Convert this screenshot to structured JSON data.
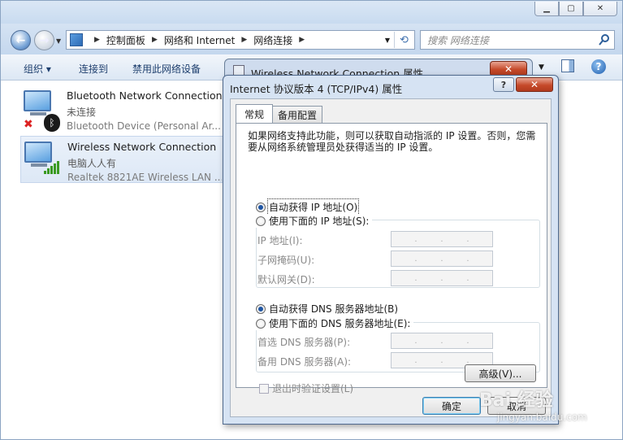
{
  "explorer": {
    "breadcrumb": [
      "控制面板",
      "网络和 Internet",
      "网络连接"
    ],
    "search_placeholder": "搜索 网络连接",
    "toolbar": {
      "organize": "组织 ▾",
      "connect": "连接到",
      "disable": "禁用此网络设备"
    },
    "connections": [
      {
        "name": "Bluetooth Network Connection",
        "status": "未连接",
        "device": "Bluetooth Device (Personal Ar..."
      },
      {
        "name": "Wireless Network Connection",
        "status": "电脑人人有",
        "device": "Realtek 8821AE Wireless LAN ..."
      }
    ]
  },
  "bg_dialog": {
    "title": "Wireless Network Connection 属性"
  },
  "dialog": {
    "title": "Internet 协议版本 4 (TCP/IPv4) 属性",
    "tabs": [
      "常规",
      "备用配置"
    ],
    "description": "如果网络支持此功能，则可以获取自动指派的 IP 设置。否则，您需要从网络系统管理员处获得适当的 IP 设置。",
    "auto_ip": "自动获得 IP 地址(O)",
    "manual_ip": "使用下面的 IP 地址(S):",
    "ip_label": "IP 地址(I):",
    "subnet_label": "子网掩码(U):",
    "gateway_label": "默认网关(D):",
    "auto_dns": "自动获得 DNS 服务器地址(B)",
    "manual_dns": "使用下面的 DNS 服务器地址(E):",
    "pref_dns_label": "首选 DNS 服务器(P):",
    "alt_dns_label": "备用 DNS 服务器(A):",
    "validate_label": "退出时验证设置(L)",
    "advanced_button": "高级(V)...",
    "ok_button": "确定",
    "cancel_button": "取消",
    "ip_placeholder": ".   .   ."
  },
  "watermark": {
    "main": "Bai 经验",
    "sub": "jingyan.baidu.com"
  },
  "colors": {
    "accent": "#1f55a3",
    "close_red": "#c64a2a",
    "chrome": "#d6e3f3"
  }
}
